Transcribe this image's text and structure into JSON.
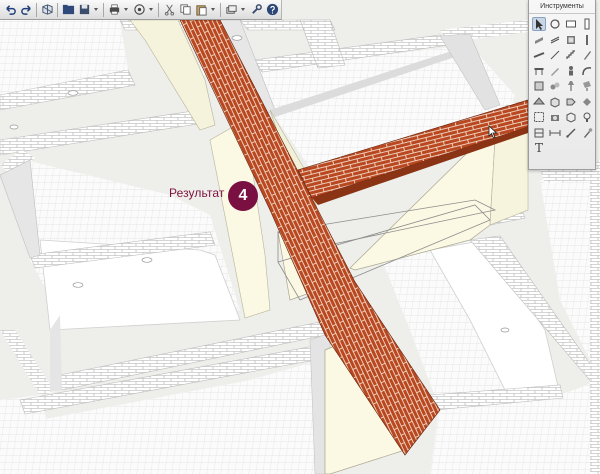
{
  "colors": {
    "brick": "#b9471f",
    "mortar": "#f2dccc",
    "accent": "#7a0f42",
    "wall_side": "#fbf8e3",
    "room_floor": "#ffffff"
  },
  "toolbar": {
    "buttons": [
      {
        "name": "undo-icon"
      },
      {
        "name": "redo-icon"
      },
      {
        "name": "model-view-icon"
      },
      {
        "name": "open-folder-icon"
      },
      {
        "name": "save-icon"
      },
      {
        "name": "print-icon"
      },
      {
        "name": "navigate-icon"
      },
      {
        "name": "cut-icon"
      },
      {
        "name": "copy-icon"
      },
      {
        "name": "paste-icon"
      },
      {
        "name": "layers-icon"
      },
      {
        "name": "settings-wrench-icon"
      },
      {
        "name": "help-icon"
      }
    ]
  },
  "tools_panel": {
    "title": "Инструменты",
    "tools": [
      "pointer-icon",
      "rotate-icon",
      "wall-icon",
      "column-icon",
      "door-icon",
      "window-icon",
      "slab-icon",
      "post-icon",
      "beam-icon",
      "line-icon",
      "stair-icon",
      "pen-icon",
      "table-icon",
      "pencil-icon",
      "person-icon",
      "curve-icon",
      "object-icon",
      "group-icon",
      "lamp-icon",
      "paint-icon",
      "roof-icon",
      "cube-icon",
      "tag-icon",
      "fill-icon",
      "zone-icon",
      "camera-icon",
      "box-icon",
      "light-icon",
      "section-icon",
      "dimension-icon",
      "measure-icon",
      "eyedropper-icon",
      "text-tool-icon"
    ],
    "text_tool_glyph": "T"
  },
  "annotation": {
    "label": "Результат",
    "step_number": "4"
  }
}
